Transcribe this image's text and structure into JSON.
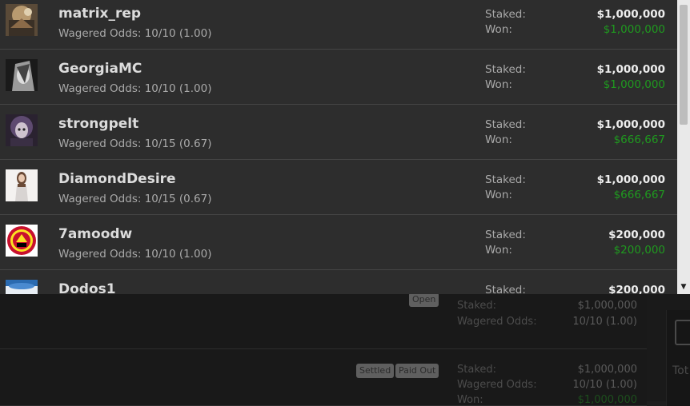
{
  "labels": {
    "staked": "Staked:",
    "won": "Won:",
    "wagered_odds": "Wagered Odds:"
  },
  "entries": [
    {
      "username": "matrix_rep",
      "odds": "Wagered Odds: 10/10 (1.00)",
      "staked": "$1,000,000",
      "won": "$1,000,000",
      "avatar_icon": "rusty-machine-avatar-icon"
    },
    {
      "username": "GeorgiaMC",
      "odds": "Wagered Odds: 10/10 (1.00)",
      "staked": "$1,000,000",
      "won": "$1,000,000",
      "avatar_icon": "bw-portrait-avatar-icon"
    },
    {
      "username": "strongpelt",
      "odds": "Wagered Odds: 10/15 (0.67)",
      "staked": "$1,000,000",
      "won": "$666,667",
      "avatar_icon": "purple-hair-avatar-icon"
    },
    {
      "username": "DiamondDesire",
      "odds": "Wagered Odds: 10/15 (0.67)",
      "staked": "$1,000,000",
      "won": "$666,667",
      "avatar_icon": "woman-photo-avatar-icon"
    },
    {
      "username": "7amoodw",
      "odds": "Wagered Odds: 10/10 (1.00)",
      "staked": "$200,000",
      "won": "$200,000",
      "avatar_icon": "club-crest-avatar-icon"
    },
    {
      "username": "Dodos1",
      "odds": "",
      "staked": "$200,000",
      "won": "",
      "avatar_icon": "blue-avatar-icon"
    }
  ],
  "background": {
    "rows": [
      {
        "badges": [
          "Open"
        ],
        "staked": "$1,000,000",
        "odds": "10/10 (1.00)"
      },
      {
        "badges": [
          "Settled",
          "Paid Out"
        ],
        "staked": "$1,000,000",
        "odds": "10/10 (1.00)",
        "won_label": "Won:",
        "won": "$1,000,000"
      }
    ],
    "side_text": "Tot"
  },
  "colors": {
    "won_green": "#1f9a1f",
    "overlay_bg": "#2d2d2d",
    "page_bg": "#1c1c1c"
  }
}
